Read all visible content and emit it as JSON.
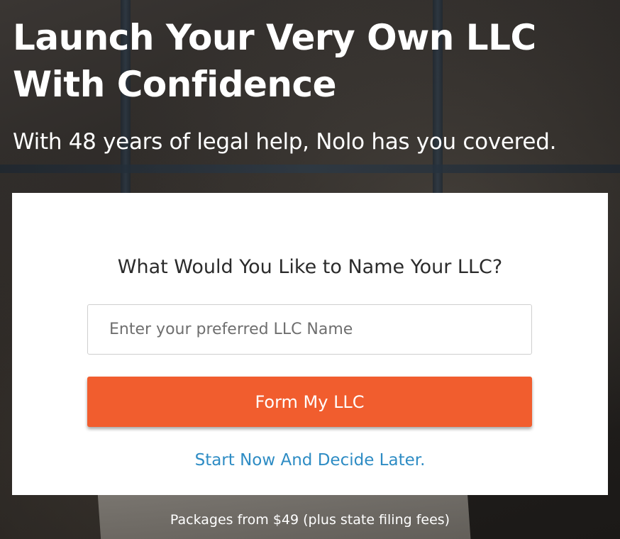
{
  "hero": {
    "title": "Launch Your Very Own LLC With Confidence",
    "subtitle": "With 48 years of legal help, Nolo has you covered."
  },
  "form": {
    "heading": "What Would You Like to Name Your LLC?",
    "input_value": "",
    "input_placeholder": "Enter your preferred LLC Name",
    "submit_label": "Form My LLC",
    "later_link": "Start Now And Decide Later."
  },
  "footer": {
    "packages_note": "Packages from $49 (plus state filing fees)"
  },
  "colors": {
    "accent": "#f15d2e",
    "link": "#2e8cc4",
    "heading_text": "#2b2b2b"
  }
}
